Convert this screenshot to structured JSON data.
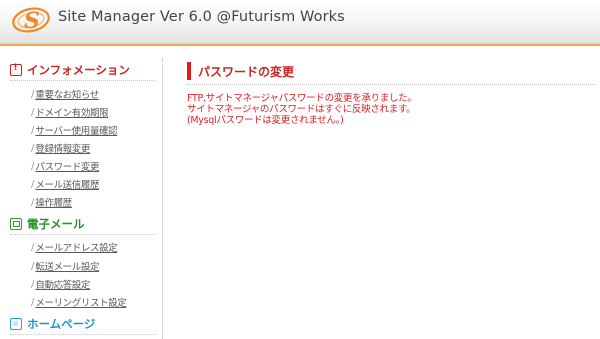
{
  "header": {
    "title": "Site Manager Ver 6.0 @Futurism Works",
    "logo_letter": "S"
  },
  "sidebar": {
    "sections": [
      {
        "title": "インフォメーション",
        "icon": "alert-icon",
        "items": [
          "重要なお知らせ",
          "ドメイン有効期限",
          "サーバー使用量確認",
          "登録情報変更",
          "パスワード変更",
          "メール送信履歴",
          "操作履歴"
        ]
      },
      {
        "title": "電子メール",
        "icon": "mail-icon",
        "items": [
          "メールアドレス設定",
          "転送メール設定",
          "自動応答設定",
          "メーリングリスト設定"
        ]
      },
      {
        "title": "ホームページ",
        "icon": "homepage-icon",
        "items": []
      }
    ]
  },
  "main": {
    "title": "パスワードの変更",
    "messages": [
      "FTP,サイトマネージャパスワードの変更を承りました。",
      "サイトマネージャのパスワードはすぐに反映されます。",
      "(Mysqlパスワードは変更されません。)"
    ]
  },
  "colors": {
    "accent_red": "#cc2222",
    "mail_green": "#2a8f2a",
    "homepage_blue": "#1f95c4",
    "header_orange": "#f4a64e"
  }
}
